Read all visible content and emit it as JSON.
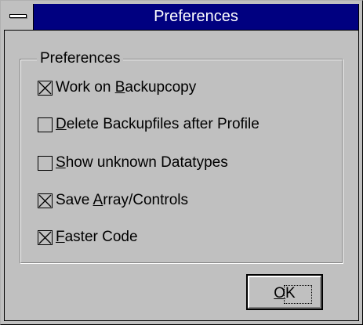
{
  "window": {
    "title": "Preferences"
  },
  "group": {
    "label": "Preferences"
  },
  "options": [
    {
      "pre": "Work on ",
      "mn": "B",
      "post": "ackupcopy",
      "checked": true
    },
    {
      "pre": "",
      "mn": "D",
      "post": "elete Backupfiles after Profile",
      "checked": false
    },
    {
      "pre": "",
      "mn": "S",
      "post": "how unknown Datatypes",
      "checked": false
    },
    {
      "pre": "Save ",
      "mn": "A",
      "post": "rray/Controls",
      "checked": true
    },
    {
      "pre": "",
      "mn": "F",
      "post": "aster Code",
      "checked": true
    }
  ],
  "buttons": {
    "ok_mnemonic": "O",
    "ok_rest": "K"
  },
  "colors": {
    "titlebar": "#000080",
    "face": "#c0c0c0"
  }
}
